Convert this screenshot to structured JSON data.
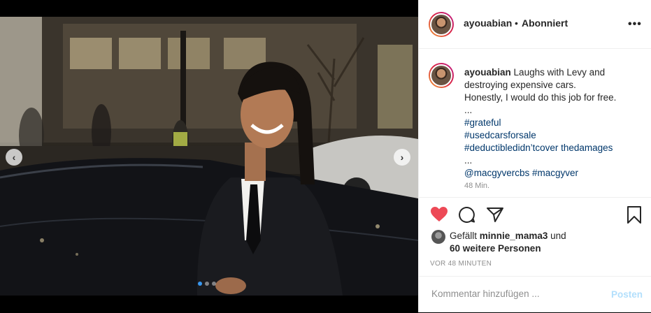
{
  "header": {
    "username": "ayouabian",
    "separator": "•",
    "follow_status": "Abonniert",
    "more_icon": "more-horizontal-icon"
  },
  "caption": {
    "username": "ayouabian",
    "lines": [
      "Laughs with Levy and destroying expensive cars.",
      "Honestly, I would do this job for free.",
      "...",
      "#grateful",
      "#usedcarsforsale",
      "#deductibledidn’tcover thedamages",
      "...",
      "@macgyvercbs #macgyver"
    ],
    "partial_timestamp": "48 Min."
  },
  "actions": {
    "like_icon": "heart-filled-icon",
    "comment_icon": "comment-icon",
    "share_icon": "paper-plane-icon",
    "save_icon": "bookmark-icon",
    "like_color": "#ed4956"
  },
  "likes": {
    "prefix": "Gefällt",
    "user": "minnie_mama3",
    "connector": "und",
    "others": "60 weitere Personen"
  },
  "post_time": "VOR 48 MINUTEN",
  "comment": {
    "placeholder": "Kommentar hinzufügen ...",
    "post_label": "Posten"
  },
  "carousel": {
    "left_arrow": "chevron-left-icon",
    "right_arrow": "chevron-right-icon",
    "dots_count": 3,
    "active_dot": 0
  },
  "colors": {
    "link": "#00376b",
    "muted": "#8e8e8e",
    "post_disabled": "#b2dffc",
    "active_dot": "#3897f0"
  }
}
